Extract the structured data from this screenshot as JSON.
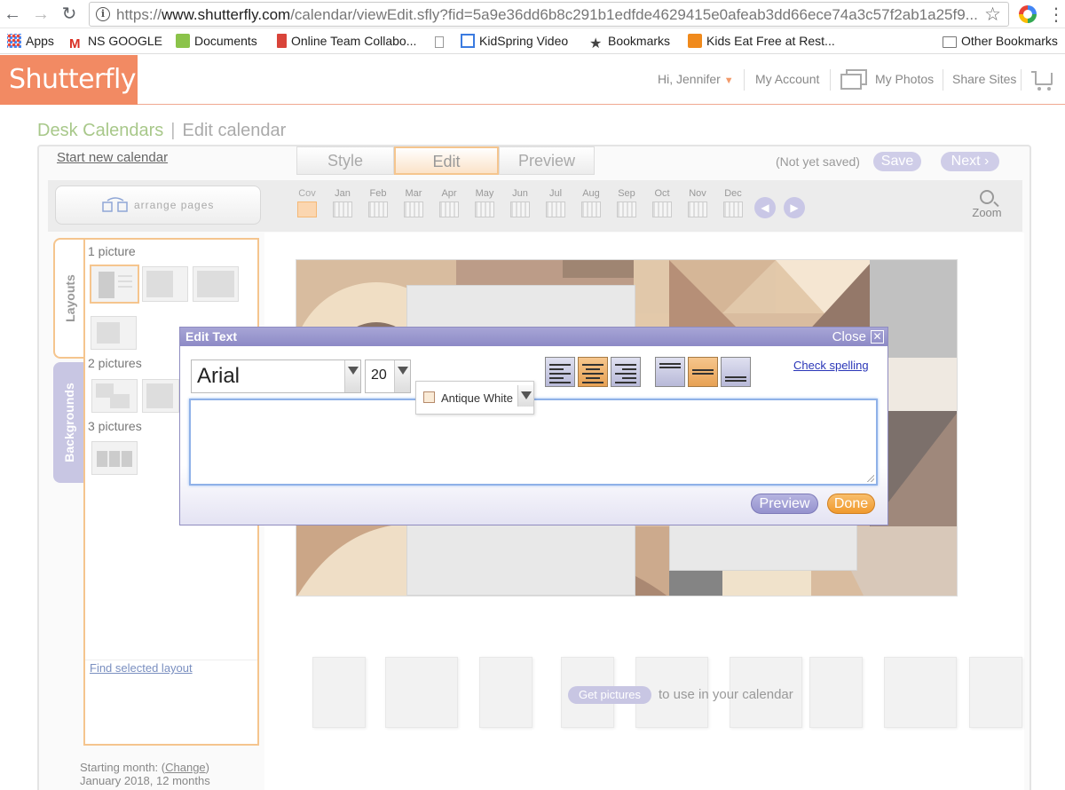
{
  "browser": {
    "url_prefix": "https://",
    "url_host": "www.shutterfly.com",
    "url_path": "/calendar/viewEdit.sfly?fid=5a9e36dd6b8c291b1edfde4629415e0afeab3dd66ece74a3c57f2ab1a25f9...",
    "bookmarks": [
      {
        "label": "Apps"
      },
      {
        "label": "NS GOOGLE"
      },
      {
        "label": "Documents"
      },
      {
        "label": "Online Team Collabo..."
      },
      {
        "label": ""
      },
      {
        "label": "KidSpring Video"
      },
      {
        "label": "Bookmarks"
      },
      {
        "label": "Kids Eat Free at Rest..."
      }
    ],
    "other_bookmarks": "Other Bookmarks"
  },
  "header": {
    "logo": "Shutterfly",
    "greeting": "Hi, Jennifer",
    "my_account": "My Account",
    "my_photos": "My Photos",
    "share_sites": "Share Sites"
  },
  "breadcrumb": {
    "product": "Desk Calendars",
    "separator": "|",
    "page": "Edit calendar"
  },
  "toolbar": {
    "start_new": "Start new calendar",
    "tabs": [
      {
        "label": "Style"
      },
      {
        "label": "Edit"
      },
      {
        "label": "Preview"
      }
    ],
    "active_tab": "Edit",
    "save_status": "(Not yet saved)",
    "save": "Save",
    "next": "Next"
  },
  "months": [
    "Cov",
    "Jan",
    "Feb",
    "Mar",
    "Apr",
    "May",
    "Jun",
    "Jul",
    "Aug",
    "Sep",
    "Oct",
    "Nov",
    "Dec"
  ],
  "selected_month": "Cov",
  "arrange_pages": "arrange pages",
  "zoom": "Zoom",
  "left_panel": {
    "tabs": {
      "layouts": "Layouts",
      "backgrounds": "Backgrounds"
    },
    "groups": [
      {
        "label": "1 picture"
      },
      {
        "label": "2 pictures"
      },
      {
        "label": "3 pictures"
      }
    ],
    "find_layout": "Find selected layout",
    "starting_month_label": "Starting month:",
    "change": "Change",
    "starting_month_value": "January 2018, 12 months"
  },
  "canvas": {
    "get_pictures": "Get pictures",
    "hint": "to use in your calendar"
  },
  "dialog": {
    "title": "Edit Text",
    "close": "Close",
    "font": "Arial",
    "size": "20",
    "color_name": "Antique White",
    "color_hex": "#faebd7",
    "check_spelling": "Check spelling",
    "text_value": "",
    "preview": "Preview",
    "done": "Done",
    "active_align": "center",
    "active_valign": "middle"
  },
  "colors": {
    "brand": "#f28a63",
    "accent_orange": "#f5c58e",
    "accent_lavender": "#c8c6e3"
  }
}
